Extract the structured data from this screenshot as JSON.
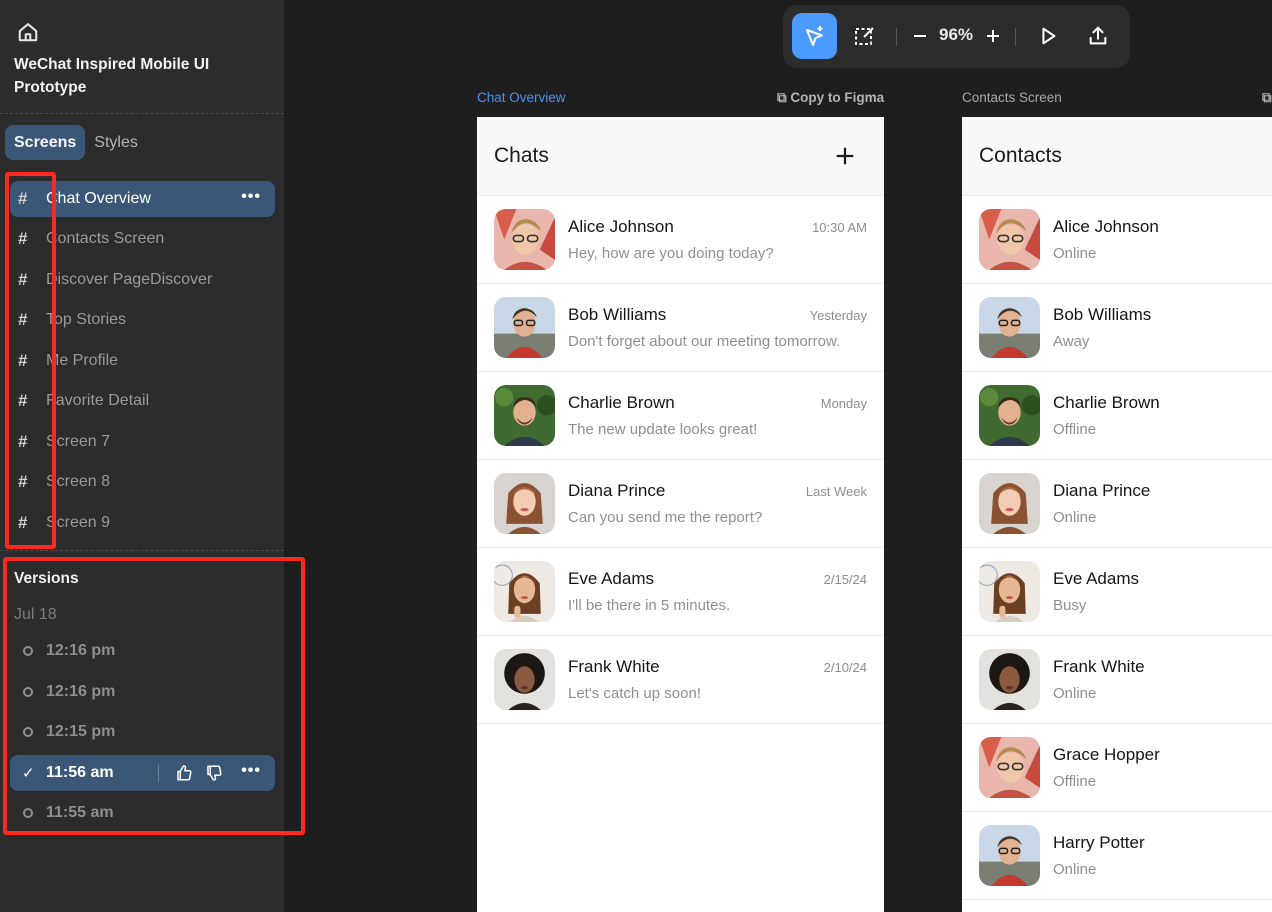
{
  "sidebar": {
    "project_title": "WeChat Inspired Mobile UI Prototype",
    "tabs": [
      {
        "label": "Screens",
        "active": true
      },
      {
        "label": "Styles",
        "active": false
      }
    ],
    "screens": [
      {
        "label": "Chat Overview",
        "active": true
      },
      {
        "label": "Contacts Screen"
      },
      {
        "label": "Discover PageDiscover"
      },
      {
        "label": "Top Stories"
      },
      {
        "label": "Me Profile"
      },
      {
        "label": "Favorite Detail"
      },
      {
        "label": "Screen 7"
      },
      {
        "label": "Screen 8"
      },
      {
        "label": "Screen 9"
      }
    ],
    "versions": {
      "title": "Versions",
      "date": "Jul 18",
      "items": [
        {
          "time": "12:16 pm"
        },
        {
          "time": "12:16 pm"
        },
        {
          "time": "12:15 pm"
        },
        {
          "time": "11:56 am",
          "active": true
        },
        {
          "time": "11:55 am"
        }
      ]
    },
    "more_glyph": "•••"
  },
  "toolbar": {
    "zoom": "96%",
    "icons": [
      "ai-cursor-icon",
      "edit-selection-icon",
      "minus-icon",
      "plus-icon",
      "play-icon",
      "export-icon"
    ]
  },
  "frames": [
    {
      "label": "Chat Overview",
      "copy_label": "Copy to Figma",
      "title": "Chats",
      "rows": [
        {
          "name": "Alice Johnson",
          "sub": "Hey, how are you doing today?",
          "time": "10:30 AM",
          "avatar": "a"
        },
        {
          "name": "Bob Williams",
          "sub": "Don't forget about our meeting tomorrow.",
          "time": "Yesterday",
          "avatar": "b"
        },
        {
          "name": "Charlie Brown",
          "sub": "The new update looks great!",
          "time": "Monday",
          "avatar": "c"
        },
        {
          "name": "Diana Prince",
          "sub": "Can you send me the report?",
          "time": "Last Week",
          "avatar": "d"
        },
        {
          "name": "Eve Adams",
          "sub": "I'll be there in 5 minutes.",
          "time": "2/15/24",
          "avatar": "e"
        },
        {
          "name": "Frank White",
          "sub": "Let's catch up soon!",
          "time": "2/10/24",
          "avatar": "f"
        }
      ]
    },
    {
      "label": "Contacts Screen",
      "title": "Contacts",
      "rows": [
        {
          "name": "Alice Johnson",
          "sub": "Online",
          "avatar": "a"
        },
        {
          "name": "Bob Williams",
          "sub": "Away",
          "avatar": "b"
        },
        {
          "name": "Charlie Brown",
          "sub": "Offline",
          "avatar": "c"
        },
        {
          "name": "Diana Prince",
          "sub": "Online",
          "avatar": "d"
        },
        {
          "name": "Eve Adams",
          "sub": "Busy",
          "avatar": "e"
        },
        {
          "name": "Frank White",
          "sub": "Online",
          "avatar": "f"
        },
        {
          "name": "Grace Hopper",
          "sub": "Offline",
          "avatar": "a"
        },
        {
          "name": "Harry Potter",
          "sub": "Online",
          "avatar": "b"
        }
      ]
    }
  ],
  "colors": {
    "accent": "#4b9bff",
    "selection": "#3b5778",
    "highlight": "#ff2a1f"
  }
}
